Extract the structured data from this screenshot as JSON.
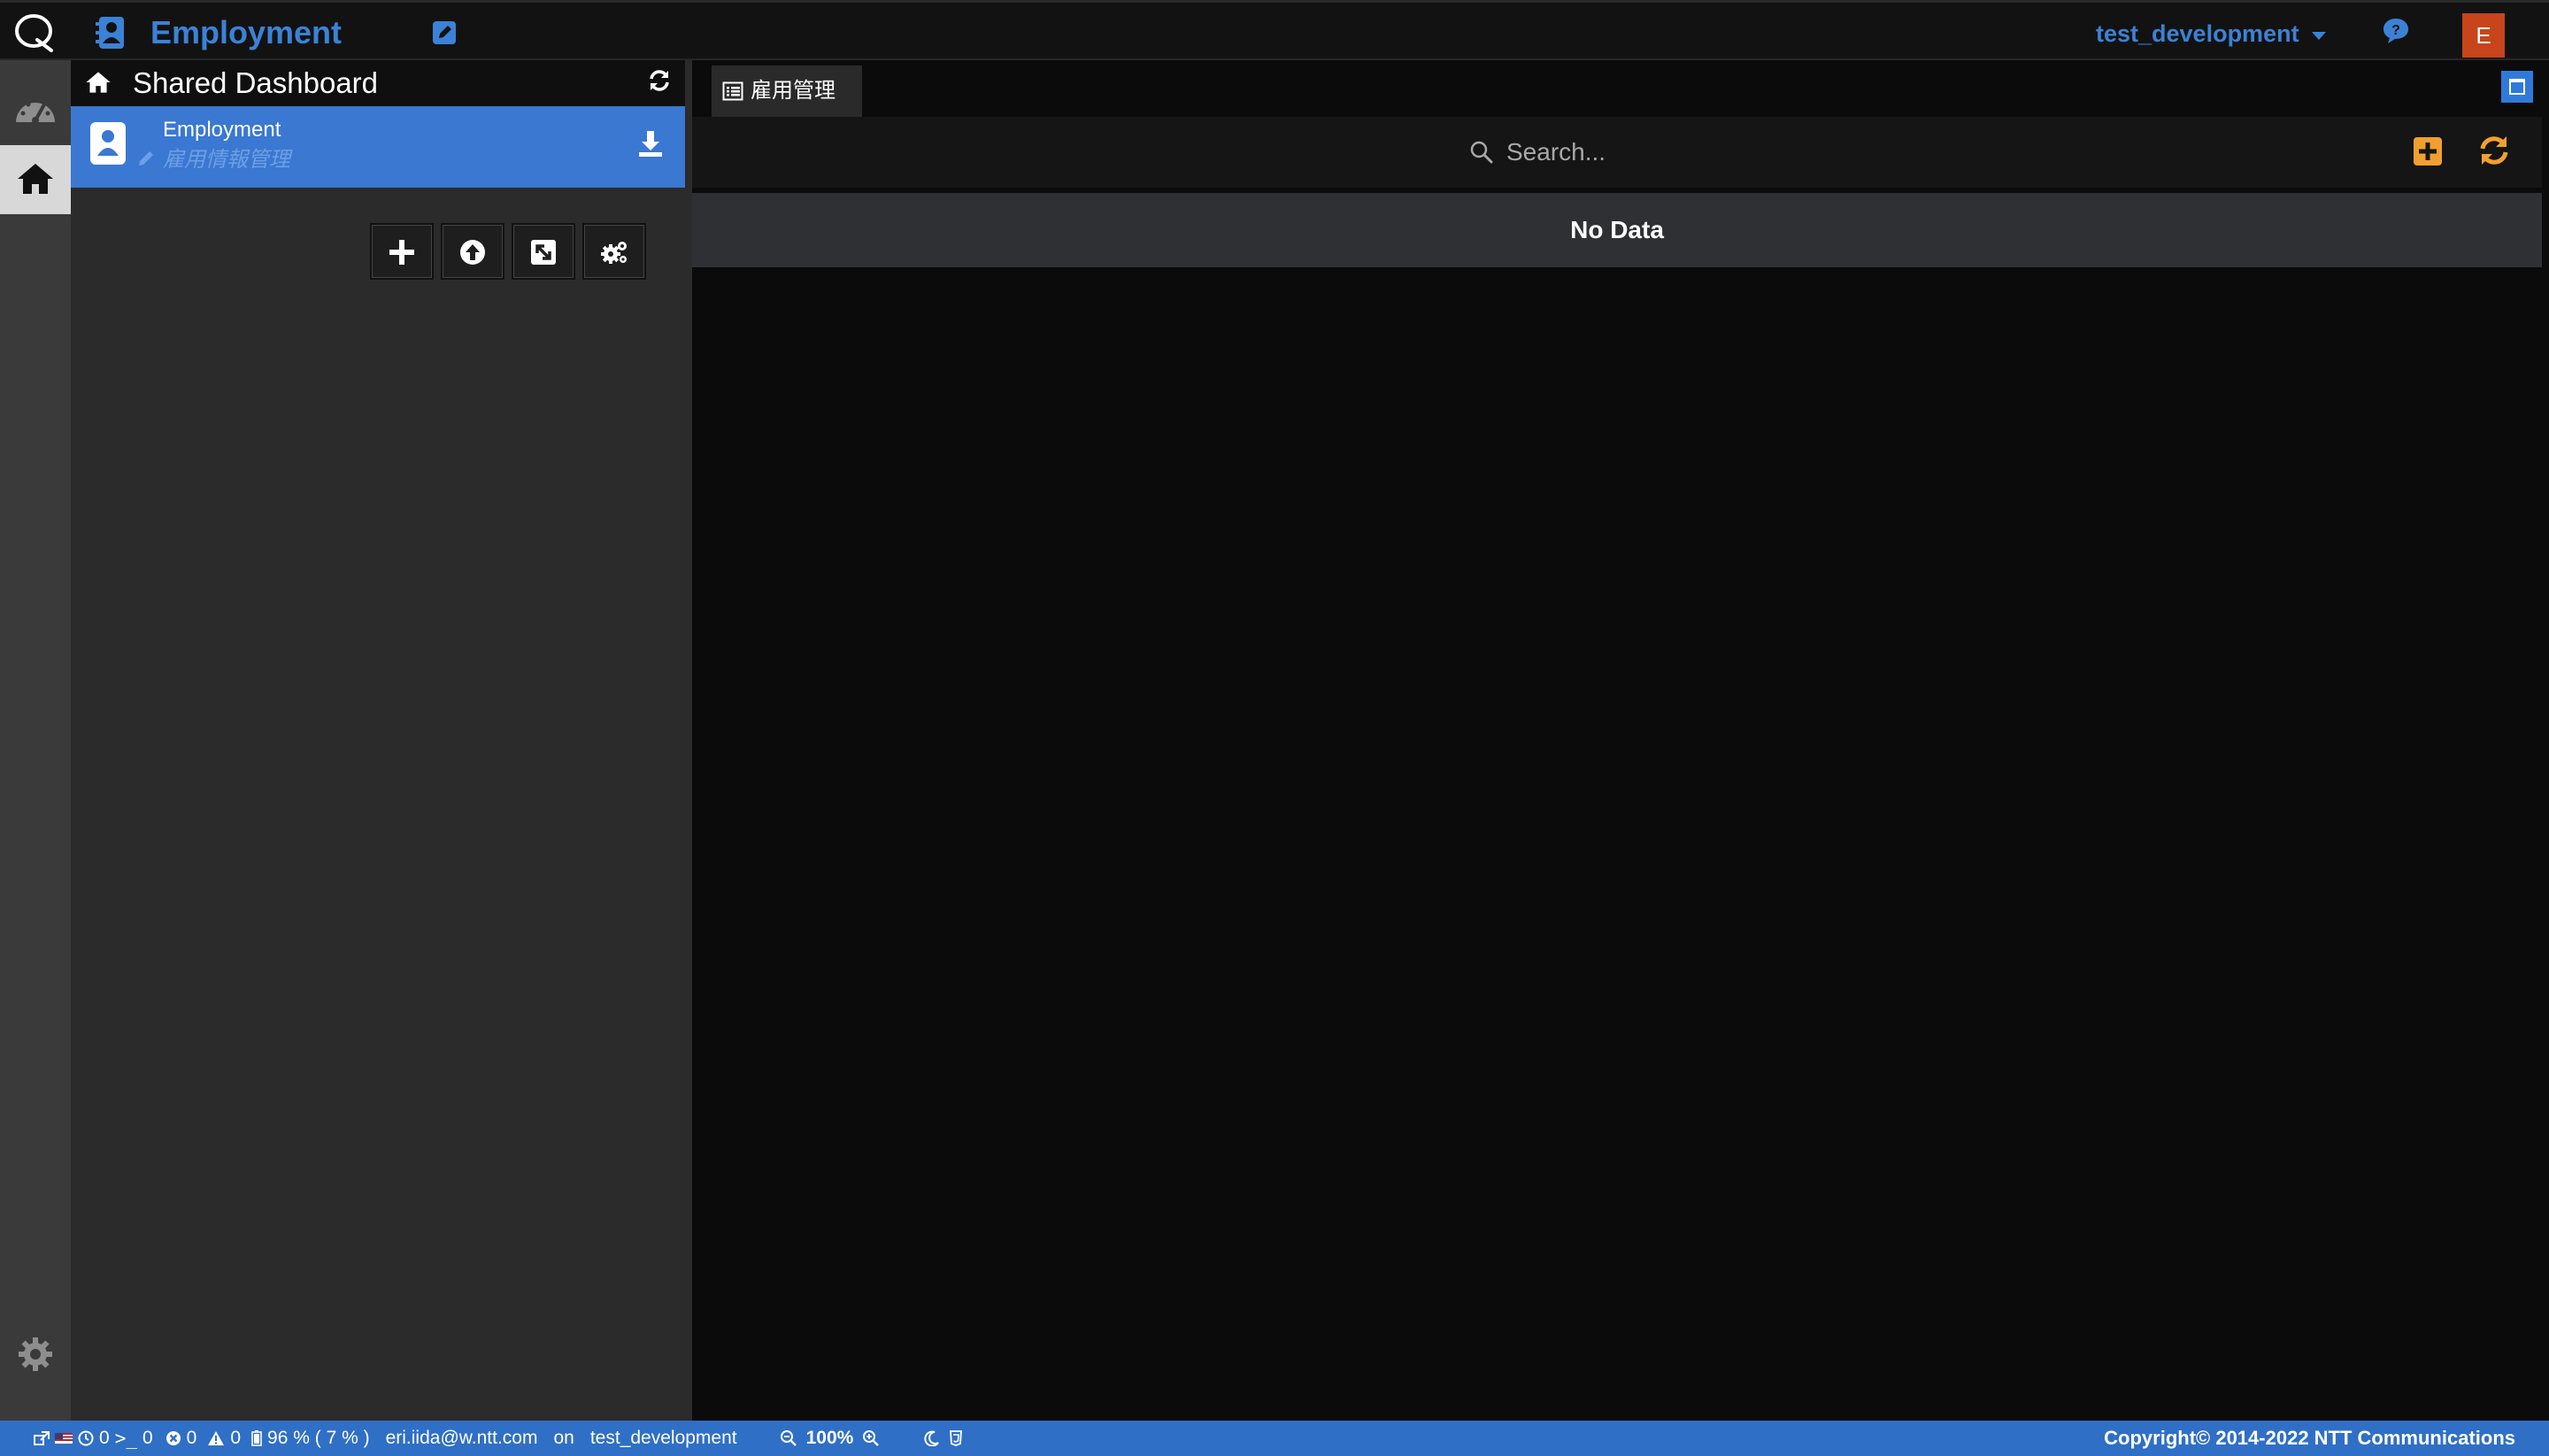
{
  "header": {
    "app_title": "Employment",
    "environment": "test_development",
    "avatar_initial": "E"
  },
  "left_panel": {
    "title": "Shared Dashboard",
    "items": [
      {
        "name": "Employment",
        "subtitle": "雇用情報管理",
        "selected": true
      }
    ]
  },
  "main": {
    "tab_label": "雇用管理",
    "search_placeholder": "Search...",
    "empty_message": "No Data"
  },
  "statusbar": {
    "timer_count": "0",
    "console_count": "0",
    "error_count": "0",
    "warning_count": "0",
    "memory": "96 % ( 7 % )",
    "user": "eri.iida@w.ntt.com",
    "on_label": "on",
    "environment": "test_development",
    "zoom": "100%",
    "copyright": "Copyright© 2014-2022 NTT Communications"
  },
  "colors": {
    "accent_blue": "#3b82d6",
    "selected_row": "#3a78d1",
    "status_bar": "#2f6fc6",
    "action_orange": "#f0a030",
    "avatar": "#c8441b"
  },
  "icons": [
    "app-logo-icon",
    "address-book-icon",
    "edit-icon",
    "help-icon",
    "dashboard-gauge-icon",
    "home-icon",
    "settings-gear-icon",
    "refresh-icon",
    "download-icon",
    "plus-icon",
    "upload-icon",
    "export-icon",
    "cogs-icon",
    "table-icon",
    "window-maximize-icon",
    "search-icon",
    "plus-square-icon",
    "sync-icon"
  ]
}
